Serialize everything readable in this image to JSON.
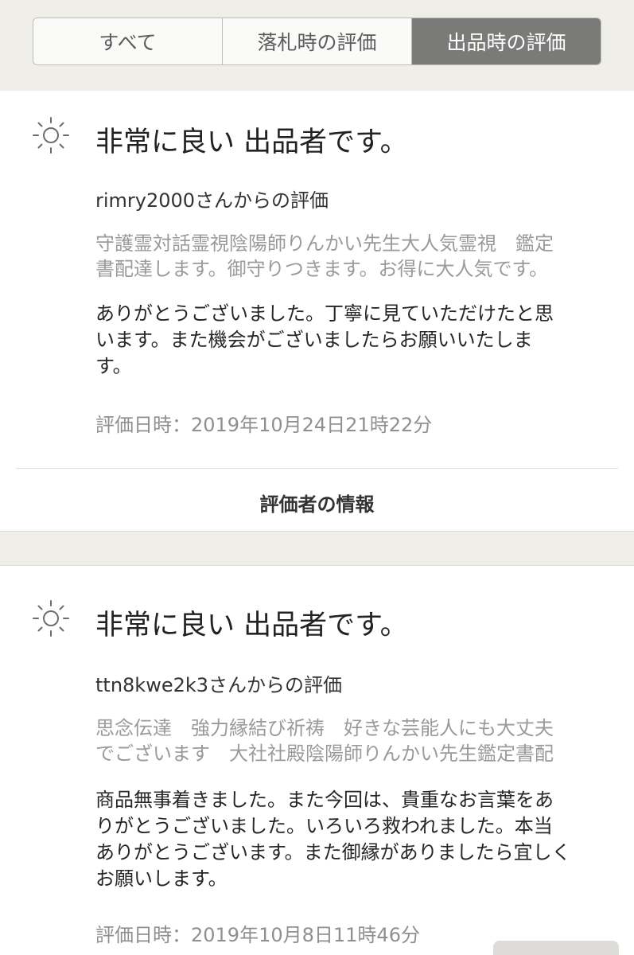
{
  "tabs": [
    {
      "label": "すべて",
      "active": false
    },
    {
      "label": "落札時の評価",
      "active": false
    },
    {
      "label": "出品時の評価",
      "active": true
    }
  ],
  "reviews": [
    {
      "icon": "sun-icon",
      "headline": "非常に良い 出品者です。",
      "from": "rimry2000さんからの評価",
      "item_lines": [
        "守護霊対話霊視陰陽師りんかい先生大人気霊視　鑑定",
        "書配達します。御守りつきます。お得に大人気です。"
      ],
      "comment_lines": [
        "ありがとうございました。丁寧に見ていただけたと思",
        "います。また機会がございましたらお願いいたしま",
        "す。"
      ],
      "date": "評価日時：2019年10月24日21時22分",
      "info_link": "評価者の情報"
    },
    {
      "icon": "sun-icon",
      "headline": "非常に良い 出品者です。",
      "from": "ttn8kwe2k3さんからの評価",
      "item_lines": [
        "思念伝達　強力縁結び祈祷　好きな芸能人にも大丈夫",
        "でございます　大社社殿陰陽師りんかい先生鑑定書配"
      ],
      "comment_lines": [
        "商品無事着きました。また今回は、貴重なお言葉をあ",
        "りがとうございました。いろいろ救われました。本当",
        "ありがとうございます。また御縁がありましたら宜しく",
        "お願いします。"
      ],
      "date": "評価日時：2019年10月8日11時46分"
    }
  ],
  "colors": {
    "page_bg": "#efeee9",
    "active_tab_bg": "#7a7a78",
    "muted_text": "#9a9a9a"
  }
}
